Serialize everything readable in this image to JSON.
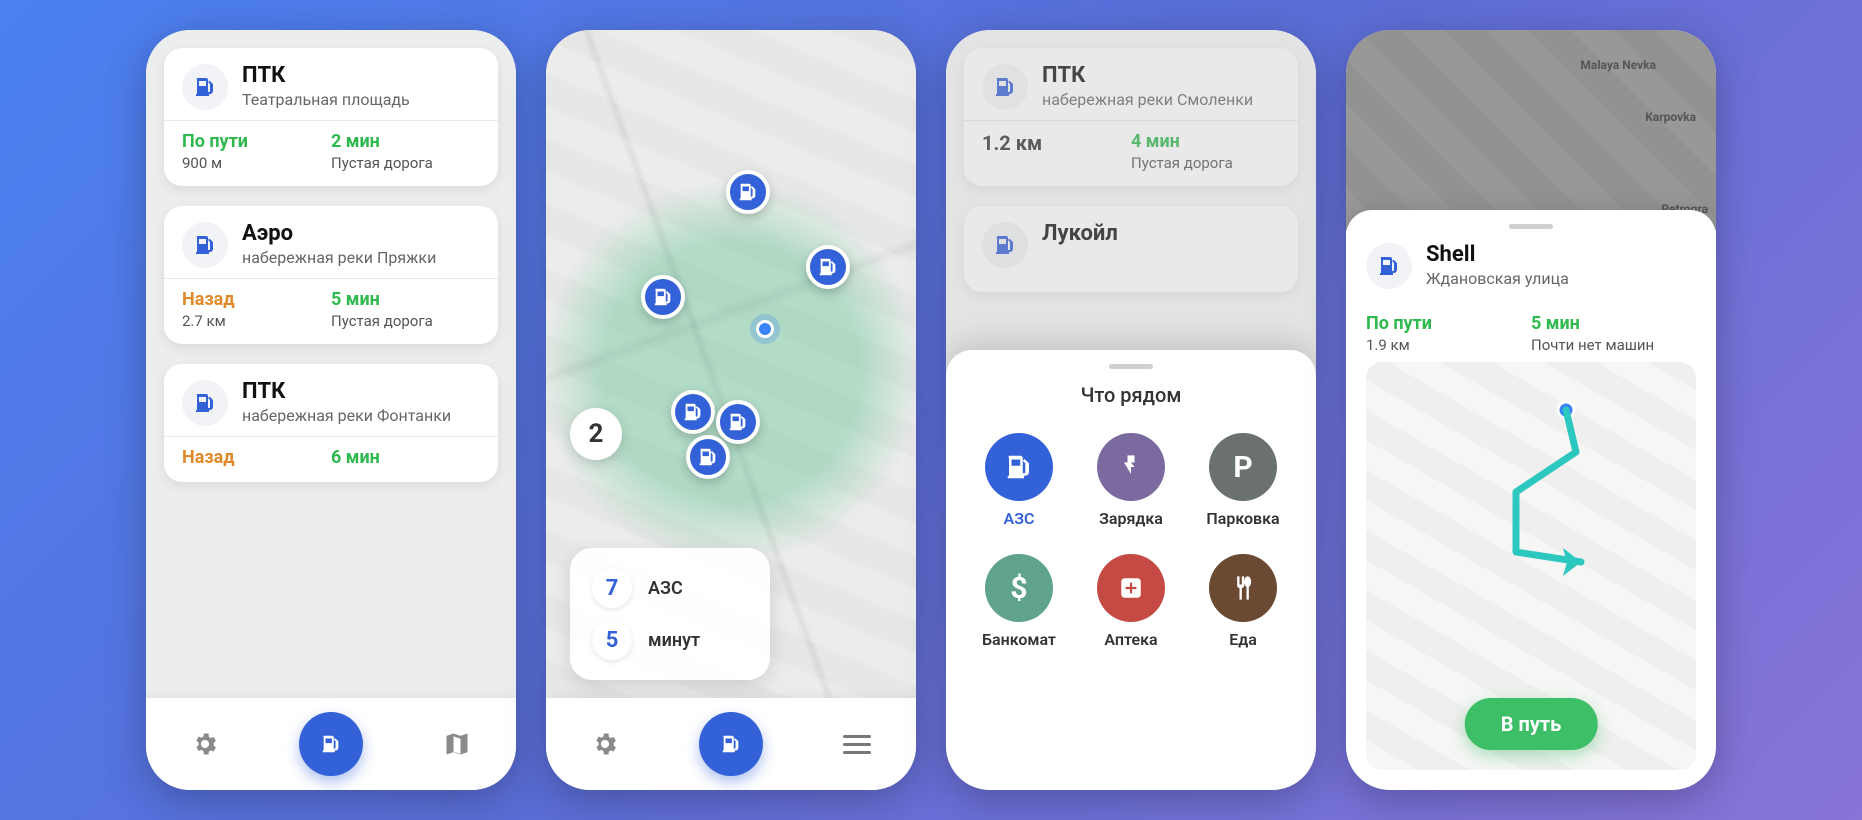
{
  "screen1": {
    "cards": [
      {
        "name": "ПТК",
        "addr": "Театральная площадь",
        "left_label": "По пути",
        "left_val": "900 м",
        "left_color": "green",
        "right_label": "2 мин",
        "right_val": "Пустая дорога"
      },
      {
        "name": "Аэро",
        "addr": "набережная реки Пряжки",
        "left_label": "Назад",
        "left_val": "2.7 км",
        "left_color": "orange",
        "right_label": "5 мин",
        "right_val": "Пустая дорога"
      },
      {
        "name": "ПТК",
        "addr": "набережная реки Фонтанки",
        "left_label": "Назад",
        "left_val": "",
        "left_color": "orange",
        "right_label": "6 мин",
        "right_val": ""
      }
    ]
  },
  "screen2": {
    "cluster": "2",
    "stats": [
      {
        "num": "7",
        "label": "АЗС"
      },
      {
        "num": "5",
        "label": "минут"
      }
    ]
  },
  "screen3": {
    "top_cards": [
      {
        "name": "ПТК",
        "addr": "набережная реки Смоленки",
        "dist": "1.2 км",
        "time": "4 мин",
        "road": "Пустая дорога"
      },
      {
        "name": "Лукойл",
        "addr": ""
      }
    ],
    "sheet_title": "Что рядом",
    "categories": [
      {
        "label": "АЗС",
        "color": "#3361d8",
        "icon": "pump",
        "active": true
      },
      {
        "label": "Зарядка",
        "color": "#7a6aa0",
        "icon": "charge",
        "active": false
      },
      {
        "label": "Парковка",
        "color": "#6b7070",
        "icon": "parking",
        "active": false
      },
      {
        "label": "Банкомат",
        "color": "#5fa28d",
        "icon": "dollar",
        "active": false
      },
      {
        "label": "Аптека",
        "color": "#c54a43",
        "icon": "med",
        "active": false
      },
      {
        "label": "Еда",
        "color": "#6b4a33",
        "icon": "food",
        "active": false
      }
    ]
  },
  "screen4": {
    "map_labels": [
      "Malaya Nevka",
      "Karpovka",
      "Petrogra"
    ],
    "name": "Shell",
    "addr": "Ждановская улица",
    "left_label": "По пути",
    "left_val": "1.9 км",
    "right_label": "5 мин",
    "right_val": "Почти нет машин",
    "go": "В путь"
  }
}
